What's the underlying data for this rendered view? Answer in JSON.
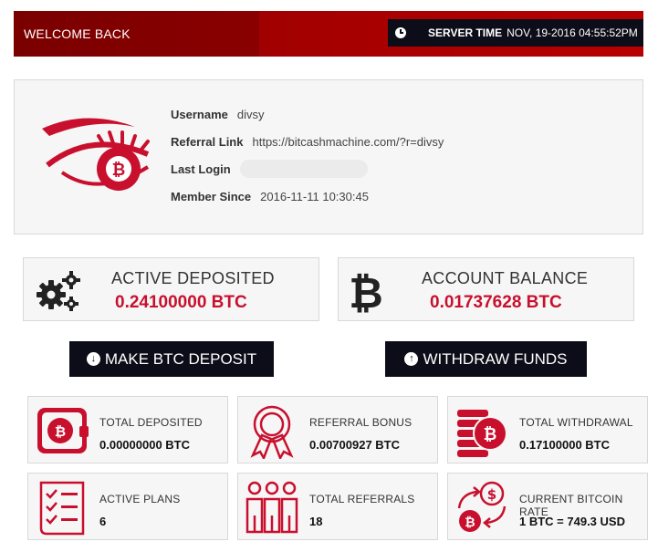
{
  "header": {
    "welcome": "WELCOME BACK",
    "server_time_label": "SERVER TIME",
    "server_time_value": "NOV, 19-2016 04:55:52PM"
  },
  "profile": {
    "username_label": "Username",
    "username": "divsy",
    "referral_label": "Referral Link",
    "referral_link": "https://bitcashmachine.com/?r=divsy",
    "last_login_label": "Last Login",
    "member_since_label": "Member Since",
    "member_since": "2016-11-11 10:30:45"
  },
  "summary": {
    "active_deposited_title": "ACTIVE DEPOSITED",
    "active_deposited_value": "0.24100000 BTC",
    "account_balance_title": "ACCOUNT BALANCE",
    "account_balance_value": "0.01737628 BTC"
  },
  "actions": {
    "deposit_label": "MAKE BTC DEPOSIT",
    "withdraw_label": "WITHDRAW FUNDS"
  },
  "stats": {
    "total_deposited": {
      "title": "TOTAL DEPOSITED",
      "value": "0.00000000 BTC"
    },
    "referral_bonus": {
      "title": "REFERRAL BONUS",
      "value": "0.00700927 BTC"
    },
    "total_withdrawal": {
      "title": "TOTAL WITHDRAWAL",
      "value": "0.17100000 BTC"
    },
    "active_plans": {
      "title": "ACTIVE PLANS",
      "value": "6"
    },
    "total_referrals": {
      "title": "TOTAL REFERRALS",
      "value": "18"
    },
    "bitcoin_rate": {
      "title": "CURRENT BITCOIN RATE",
      "value": "1 BTC = 749.3 USD"
    }
  },
  "icons": {
    "clock": "clock-icon",
    "logo": "eye-bitcoin-logo",
    "gears": "gears-icon",
    "bitcoin": "bitcoin-icon",
    "deposit": "arrow-circle-down-icon",
    "withdraw": "arrow-circle-up-icon",
    "wallet": "wallet-icon",
    "ribbon": "award-ribbon-icon",
    "coins": "coin-stack-icon",
    "checklist": "checklist-icon",
    "people": "people-group-icon",
    "exchange": "currency-exchange-icon"
  },
  "colors": {
    "brand_red": "#c8102e",
    "dark_navy": "#0d0d1a",
    "panel_bg": "#f6f6f6"
  }
}
